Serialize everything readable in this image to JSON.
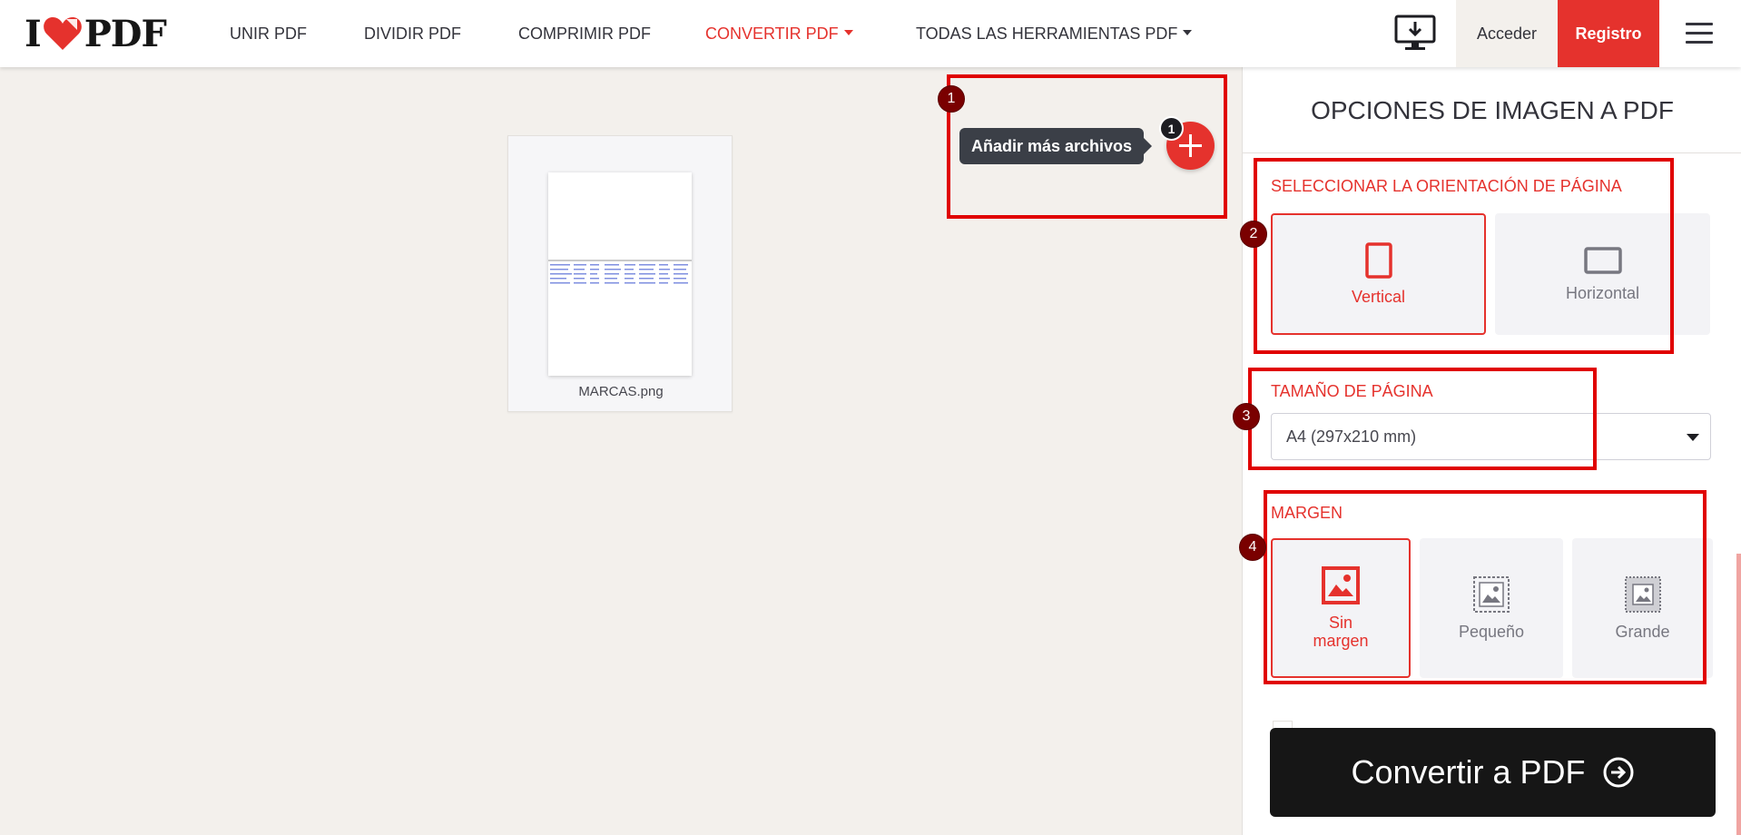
{
  "brand": {
    "logo_left": "I",
    "logo_right": "PDF",
    "accent_color": "#e5322d"
  },
  "nav": {
    "items": [
      {
        "label": "UNIR PDF"
      },
      {
        "label": "DIVIDIR PDF"
      },
      {
        "label": "COMPRIMIR PDF"
      },
      {
        "label": "CONVERTIR PDF"
      },
      {
        "label": "TODAS LAS HERRAMIENTAS PDF"
      }
    ],
    "acceder": "Acceder",
    "registro": "Registro",
    "desktop_icon": "desktop-download-icon",
    "menu_icon": "hamburger-menu-icon"
  },
  "workspace": {
    "file_name": "MARCAS.png",
    "add_tooltip": "Añadir más archivos",
    "file_count": "1"
  },
  "annotations": [
    "1",
    "2",
    "3",
    "4"
  ],
  "sidebar": {
    "title": "OPCIONES DE IMAGEN A PDF",
    "orientation": {
      "label": "SELECCIONAR LA ORIENTACIÓN DE PÁGINA",
      "options": [
        {
          "label": "Vertical",
          "selected": true
        },
        {
          "label": "Horizontal",
          "selected": false
        }
      ]
    },
    "page_size": {
      "label": "TAMAÑO DE PÁGINA",
      "value": "A4 (297x210 mm)"
    },
    "margin": {
      "label": "MARGEN",
      "options": [
        {
          "label": "Sin margen",
          "selected": true
        },
        {
          "label": "Pequeño",
          "selected": false
        },
        {
          "label": "Grande",
          "selected": false
        }
      ]
    },
    "convert_label": "Convertir a PDF"
  }
}
